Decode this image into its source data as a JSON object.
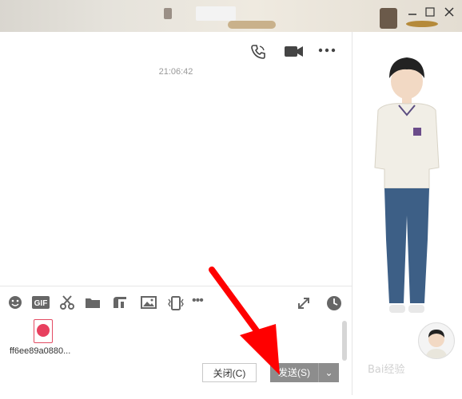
{
  "titlebar": {
    "controls": [
      "minimize-icon",
      "maximize-icon",
      "close-icon"
    ]
  },
  "header_icons": [
    "phone-icon",
    "video-icon",
    "more-icon"
  ],
  "chat": {
    "timestamp": "21:06:42"
  },
  "toolbar": {
    "items": [
      {
        "name": "emoji-icon"
      },
      {
        "name": "gif-icon",
        "label": "GIF"
      },
      {
        "name": "scissors-icon"
      },
      {
        "name": "folder-icon"
      },
      {
        "name": "quote-icon"
      },
      {
        "name": "image-icon"
      },
      {
        "name": "shake-icon"
      },
      {
        "name": "more-icon",
        "label": "•••"
      },
      {
        "name": "expand-icon"
      },
      {
        "name": "clock-icon"
      }
    ]
  },
  "attachment": {
    "file_name": "ff6ee89a0880..."
  },
  "buttons": {
    "close": "关闭(C)",
    "send": "发送(S)",
    "send_dropdown": "⌄"
  },
  "watermark": "Bai经验",
  "colors": {
    "send_bg": "#8d8d8d",
    "arrow_red": "#ff0000",
    "file_icon": "#e8405f"
  }
}
